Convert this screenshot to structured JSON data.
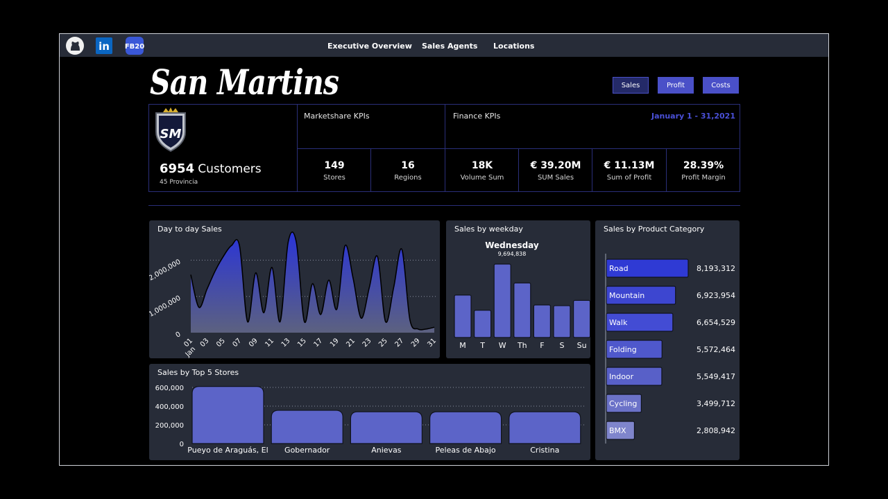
{
  "nav": {
    "links": [
      "Executive Overview",
      "Sales Agents",
      "Locations"
    ],
    "icons": [
      "github-icon",
      "linkedin-icon",
      "fb20-icon"
    ],
    "fb20_label": "FB20",
    "linkedin_label": "in"
  },
  "brand": "San Martins",
  "toggle_buttons": {
    "sales": "Sales",
    "profit": "Profit",
    "costs": "Costs"
  },
  "logo": {
    "monogram": "SM"
  },
  "customers": {
    "count": "6954",
    "label": "Customers",
    "sub": "45 Provincia"
  },
  "marketshare": {
    "header": "Marketshare KPIs",
    "kpis": [
      {
        "value": "149",
        "label": "Stores"
      },
      {
        "value": "16",
        "label": "Regions"
      }
    ]
  },
  "finance": {
    "header": "Finance KPIs",
    "date_range": "January 1 - 31,2021",
    "kpis": [
      {
        "value": "18K",
        "label": "Volume Sum"
      },
      {
        "value": "€ 39.20M",
        "label": "SUM Sales"
      },
      {
        "value": "€ 11.13M",
        "label": "Sum of Profit"
      },
      {
        "value": "28.39%",
        "label": "Profit Margin"
      }
    ]
  },
  "colors": {
    "accent": "#3a44d8",
    "bar": "#6169d2",
    "panel": "#272c38",
    "btn_active": "#242a68",
    "btn": "#4a50c8"
  },
  "chart_data": [
    {
      "type": "area",
      "title": "Day to day Sales",
      "x": [
        "01",
        "02",
        "03",
        "04",
        "05",
        "06",
        "07",
        "08",
        "09",
        "10",
        "11",
        "12",
        "13",
        "14",
        "15",
        "16",
        "17",
        "18",
        "19",
        "20",
        "21",
        "22",
        "23",
        "24",
        "25",
        "26",
        "27",
        "28",
        "29",
        "30",
        "31"
      ],
      "x_tick_labels": [
        "01",
        "03",
        "05",
        "07",
        "09",
        "11",
        "13",
        "15",
        "17",
        "19",
        "21",
        "23",
        "25",
        "27",
        "29",
        "31"
      ],
      "x_sublabel": "Jan",
      "y_ticks": [
        "0",
        "1,000,000",
        "2,000,000"
      ],
      "values": [
        1600000,
        700000,
        1200000,
        1700000,
        2100000,
        2400000,
        2400000,
        300000,
        1650000,
        550000,
        1800000,
        300000,
        2500000,
        2500000,
        300000,
        1350000,
        500000,
        1450000,
        650000,
        2400000,
        1500000,
        400000,
        1250000,
        2100000,
        300000,
        1250000,
        2300000,
        350000,
        100000,
        100000,
        150000
      ],
      "ylim": [
        0,
        2600000
      ]
    },
    {
      "type": "bar",
      "title": "Sales by weekday",
      "highlight_label": "Wednesday",
      "highlight_value": "9,694,838",
      "categories": [
        "M",
        "T",
        "W",
        "Th",
        "F",
        "S",
        "Su"
      ],
      "values": [
        5600000,
        3600000,
        9694838,
        7200000,
        4300000,
        4200000,
        4900000
      ],
      "ylim": [
        0,
        9694838
      ]
    },
    {
      "type": "bar",
      "title": "Sales by Product Category",
      "orientation": "horizontal",
      "categories": [
        "Road",
        "Mountain",
        "Walk",
        "Folding",
        "Indoor",
        "Cycling",
        "BMX"
      ],
      "values": [
        8193312,
        6923954,
        6654529,
        5572464,
        5549417,
        3499712,
        2808942
      ],
      "value_labels": [
        "8,193,312",
        "6,923,954",
        "6,654,529",
        "5,572,464",
        "5,549,417",
        "3,499,712",
        "2,808,942"
      ]
    },
    {
      "type": "bar",
      "title": "Sales by Top 5 Stores",
      "categories": [
        "Pueyo de Araguás, El",
        "Gobernador",
        "Anievas",
        "Peleas de Abajo",
        "Cristina"
      ],
      "values": [
        610000,
        355000,
        340000,
        340000,
        340000
      ],
      "y_ticks": [
        "0",
        "200,000",
        "400,000",
        "600,000"
      ],
      "ylim": [
        0,
        600000
      ]
    }
  ]
}
